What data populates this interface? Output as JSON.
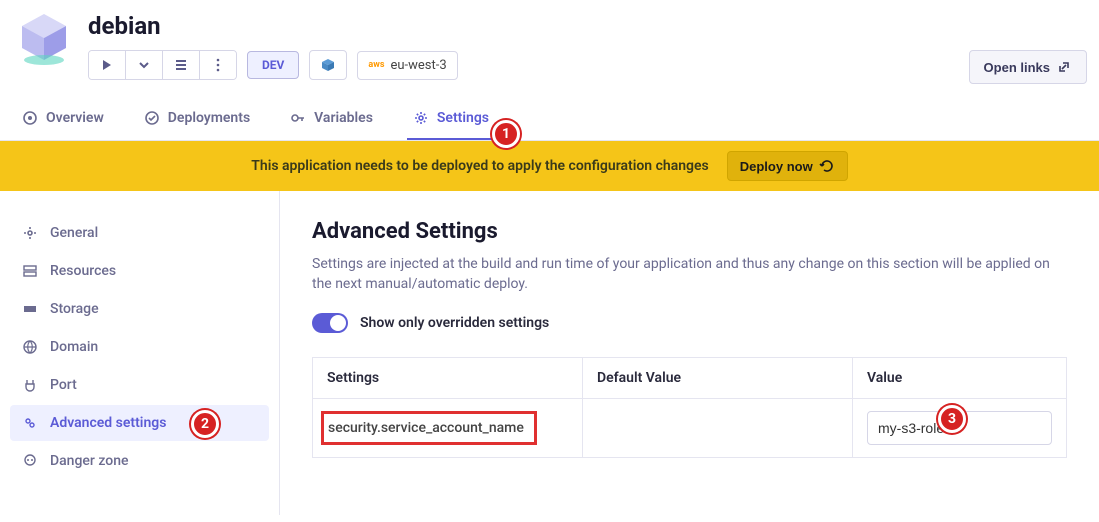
{
  "app": {
    "title": "debian"
  },
  "toolbar": {
    "env_label": "DEV",
    "region": "eu-west-3",
    "open_links": "Open links"
  },
  "tabs": [
    {
      "key": "overview",
      "label": "Overview"
    },
    {
      "key": "deployments",
      "label": "Deployments"
    },
    {
      "key": "variables",
      "label": "Variables"
    },
    {
      "key": "settings",
      "label": "Settings",
      "active": true
    }
  ],
  "banner": {
    "message": "This application needs to be deployed to apply the configuration changes",
    "action": "Deploy now"
  },
  "sidebar": {
    "items": [
      {
        "key": "general",
        "label": "General"
      },
      {
        "key": "resources",
        "label": "Resources"
      },
      {
        "key": "storage",
        "label": "Storage"
      },
      {
        "key": "domain",
        "label": "Domain"
      },
      {
        "key": "port",
        "label": "Port"
      },
      {
        "key": "advanced",
        "label": "Advanced settings",
        "active": true
      },
      {
        "key": "danger",
        "label": "Danger zone"
      }
    ]
  },
  "main": {
    "heading": "Advanced Settings",
    "description": "Settings are injected at the build and run time of your application and thus any change on this section will be applied on the next manual/automatic deploy.",
    "toggle_label": "Show only overridden settings",
    "toggle_on": true,
    "table": {
      "cols": [
        "Settings",
        "Default Value",
        "Value"
      ],
      "rows": [
        {
          "setting": "security.service_account_name",
          "default": "",
          "value": "my-s3-role"
        }
      ]
    }
  },
  "markers": {
    "1": "1",
    "2": "2",
    "3": "3"
  }
}
